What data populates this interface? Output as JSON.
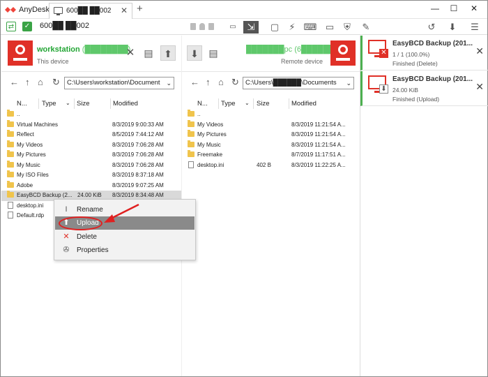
{
  "app": {
    "name": "AnyDesk",
    "tab_label": "600██ ██002",
    "new_tab": "+",
    "window_controls": [
      "minimize",
      "maximize",
      "close"
    ]
  },
  "toolbar": {
    "address": "600██ ██002",
    "icons": [
      "display-icon",
      "file-transfer-icon",
      "chat-icon",
      "actions-icon",
      "keyboard-icon",
      "monitor-icon",
      "permissions-icon",
      "whiteboard-icon",
      "history-icon",
      "save-icon",
      "menu-icon"
    ]
  },
  "local": {
    "name": "workstation",
    "id_blurred": "(████████)",
    "subtitle": "This device",
    "path": "C:\\Users\\workstation\\Document",
    "columns": [
      "N...",
      "Type",
      "Size",
      "Modified"
    ],
    "files": [
      {
        "name": "..",
        "kind": "folder",
        "size": "",
        "modified": ""
      },
      {
        "name": "Virtual Machines",
        "kind": "folder",
        "size": "",
        "modified": "8/3/2019 9:00:33 AM"
      },
      {
        "name": "Reflect",
        "kind": "folder",
        "size": "",
        "modified": "8/5/2019 7:44:12 AM"
      },
      {
        "name": "My Videos",
        "kind": "folder",
        "size": "",
        "modified": "8/3/2019 7:06:28 AM"
      },
      {
        "name": "My Pictures",
        "kind": "folder",
        "size": "",
        "modified": "8/3/2019 7:06:28 AM"
      },
      {
        "name": "My Music",
        "kind": "folder",
        "size": "",
        "modified": "8/3/2019 7:06:28 AM"
      },
      {
        "name": "My ISO Files",
        "kind": "folder",
        "size": "",
        "modified": "8/3/2019 8:37:18 AM"
      },
      {
        "name": "Adobe",
        "kind": "folder",
        "size": "",
        "modified": "8/3/2019 9:07:25 AM"
      },
      {
        "name": "EasyBCD Backup (2...",
        "kind": "folder",
        "size": "24.00 KiB",
        "modified": "8/3/2019 8:34:48 AM",
        "selected": true
      },
      {
        "name": "desktop.ini",
        "kind": "file",
        "size": "",
        "modified": ""
      },
      {
        "name": "Default.rdp",
        "kind": "file",
        "size": "",
        "modified": ""
      }
    ]
  },
  "remote": {
    "name": "███████pc",
    "id_blurred": "(6███████)",
    "subtitle": "Remote device",
    "path": "C:\\Users\\██████\\Documents",
    "columns": [
      "N...",
      "Type",
      "Size",
      "Modified"
    ],
    "files": [
      {
        "name": "..",
        "kind": "folder",
        "size": "",
        "modified": ""
      },
      {
        "name": "My Videos",
        "kind": "folder",
        "size": "",
        "modified": "8/3/2019 11:21:54 A..."
      },
      {
        "name": "My Pictures",
        "kind": "folder",
        "size": "",
        "modified": "8/3/2019 11:21:54 A..."
      },
      {
        "name": "My Music",
        "kind": "folder",
        "size": "",
        "modified": "8/3/2019 11:21:54 A..."
      },
      {
        "name": "Freemake",
        "kind": "folder",
        "size": "",
        "modified": "8/7/2019 11:17:51 A..."
      },
      {
        "name": "desktop.ini",
        "kind": "file",
        "size": "402 B",
        "modified": "8/3/2019 11:22:25 A..."
      }
    ]
  },
  "context_menu": {
    "items": [
      {
        "label": "Rename",
        "icon": "rename-icon",
        "glyph": "I"
      },
      {
        "label": "Upload",
        "icon": "upload-icon",
        "glyph": "⬆",
        "highlighted": true
      },
      {
        "label": "Delete",
        "icon": "delete-icon",
        "glyph": "✕"
      },
      {
        "label": "Properties",
        "icon": "wrench-icon",
        "glyph": "🔧"
      }
    ]
  },
  "transfers": [
    {
      "title": "EasyBCD Backup (201...",
      "line1": "1 / 1 (100.0%)",
      "line2": "Finished (Delete)",
      "badge": "delete"
    },
    {
      "title": "EasyBCD Backup (201...",
      "line1": "24.00 KiB",
      "line2": "Finished (Upload)",
      "badge": "upload"
    }
  ],
  "colors": {
    "accent_red": "#e03027",
    "device_green": "#22a534",
    "transfer_bar_green": "#4caf50",
    "selection_gray": "#d9d9d9",
    "folder_yellow": "#f0c44c"
  }
}
